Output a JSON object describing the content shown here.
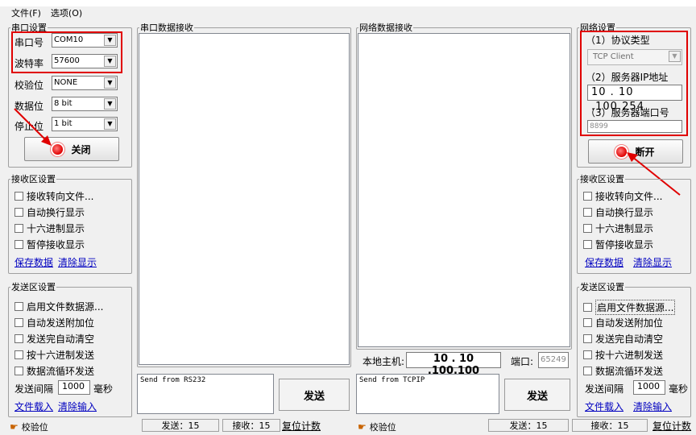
{
  "menu": {
    "file": "文件(F)",
    "options": "选项(O)"
  },
  "serial": {
    "group_title": "串口设置",
    "port_label": "串口号",
    "port_value": "COM10",
    "baud_label": "波特率",
    "baud_value": "57600",
    "parity_label": "校验位",
    "parity_value": "NONE",
    "databits_label": "数据位",
    "databits_value": "8 bit",
    "stopbits_label": "停止位",
    "stopbits_value": "1 bit",
    "close_label": "关闭"
  },
  "left_recv": {
    "title": "接收区设置",
    "opts": [
      "接收转向文件...",
      "自动换行显示",
      "十六进制显示",
      "暂停接收显示"
    ],
    "save": "保存数据",
    "clear": "清除显示"
  },
  "left_send": {
    "title": "发送区设置",
    "opts": [
      "启用文件数据源...",
      "自动发送附加位",
      "发送完自动清空",
      "按十六进制发送",
      "数据流循环发送"
    ],
    "interval_label": "发送间隔",
    "interval_value": "1000",
    "interval_unit": "毫秒",
    "load": "文件载入",
    "clear": "清除输入"
  },
  "serial_recv": {
    "title": "串口数据接收"
  },
  "serial_send": {
    "text": "Send from RS232",
    "send": "发送"
  },
  "net_recv": {
    "title": "网络数据接收"
  },
  "net_bar": {
    "host_label": "本地主机:",
    "host_value": "10 . 10 .100.100",
    "port_label": "端口:",
    "port_value": "65249"
  },
  "net_send": {
    "text": "Send from TCPIP",
    "send": "发送"
  },
  "net": {
    "group_title": "网络设置",
    "proto_label": "（1）协议类型",
    "proto_value": "TCP Client",
    "ip_label": "（2）服务器IP地址",
    "ip_value": "10 . 10 .100.254",
    "port_label": "（3）服务器端口号",
    "port_value": "8899",
    "disconnect_label": "断开"
  },
  "right_recv": {
    "title": "接收区设置",
    "opts": [
      "接收转向文件...",
      "自动换行显示",
      "十六进制显示",
      "暂停接收显示"
    ],
    "save": "保存数据",
    "clear": "清除显示"
  },
  "right_send": {
    "title": "发送区设置",
    "opts": [
      "启用文件数据源...",
      "自动发送附加位",
      "发送完自动清空",
      "按十六进制发送",
      "数据流循环发送"
    ],
    "interval_label": "发送间隔",
    "interval_value": "1000",
    "interval_unit": "毫秒",
    "load": "文件载入",
    "clear": "清除输入"
  },
  "status_left": {
    "check": "校验位",
    "sent": "发送：15",
    "recv": "接收：15",
    "reset": "复位计数"
  },
  "status_right": {
    "check": "校验位",
    "sent": "发送：15",
    "recv": "接收：15",
    "reset": "复位计数"
  },
  "colors": {
    "highlight": "#e00000",
    "link": "#0000c0"
  }
}
